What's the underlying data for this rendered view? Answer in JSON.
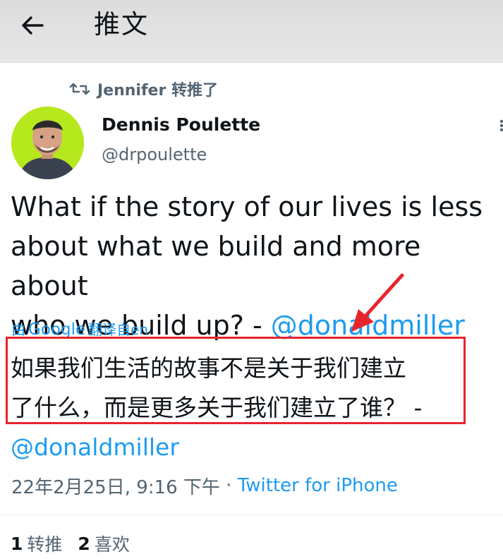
{
  "header": {
    "back_label": "←",
    "title": "推文"
  },
  "retweet": {
    "icon": "retweet-icon",
    "text": "Jennifer 转推了"
  },
  "author": {
    "name": "Dennis Poulette",
    "handle": "@drpoulette",
    "avatar_bg": "#b6e81e"
  },
  "tweet": {
    "text": "What if the story of our lives is less\nabout what we build and more about\nwho we build up? - ",
    "mention": "@donaldmiller"
  },
  "translation": {
    "prefix": "由",
    "provider": "Google",
    "suffix": "翻译自en",
    "line1": "如果我们生活的故事不是关于我们建立",
    "line2": "了什么，而是更多关于我们建立了谁？ -",
    "mention": "@donaldmiller",
    "highlight_color": "#e8232b"
  },
  "meta": {
    "timestamp": "22年2月25日, 9:16 下午",
    "separator": " · ",
    "source": "Twitter for iPhone"
  },
  "stats": {
    "retweets_count": "1",
    "retweets_label": "转推",
    "likes_count": "2",
    "likes_label": "喜欢"
  },
  "colors": {
    "accent": "#1d9bf0",
    "text": "#0f1419",
    "muted": "#536471"
  }
}
